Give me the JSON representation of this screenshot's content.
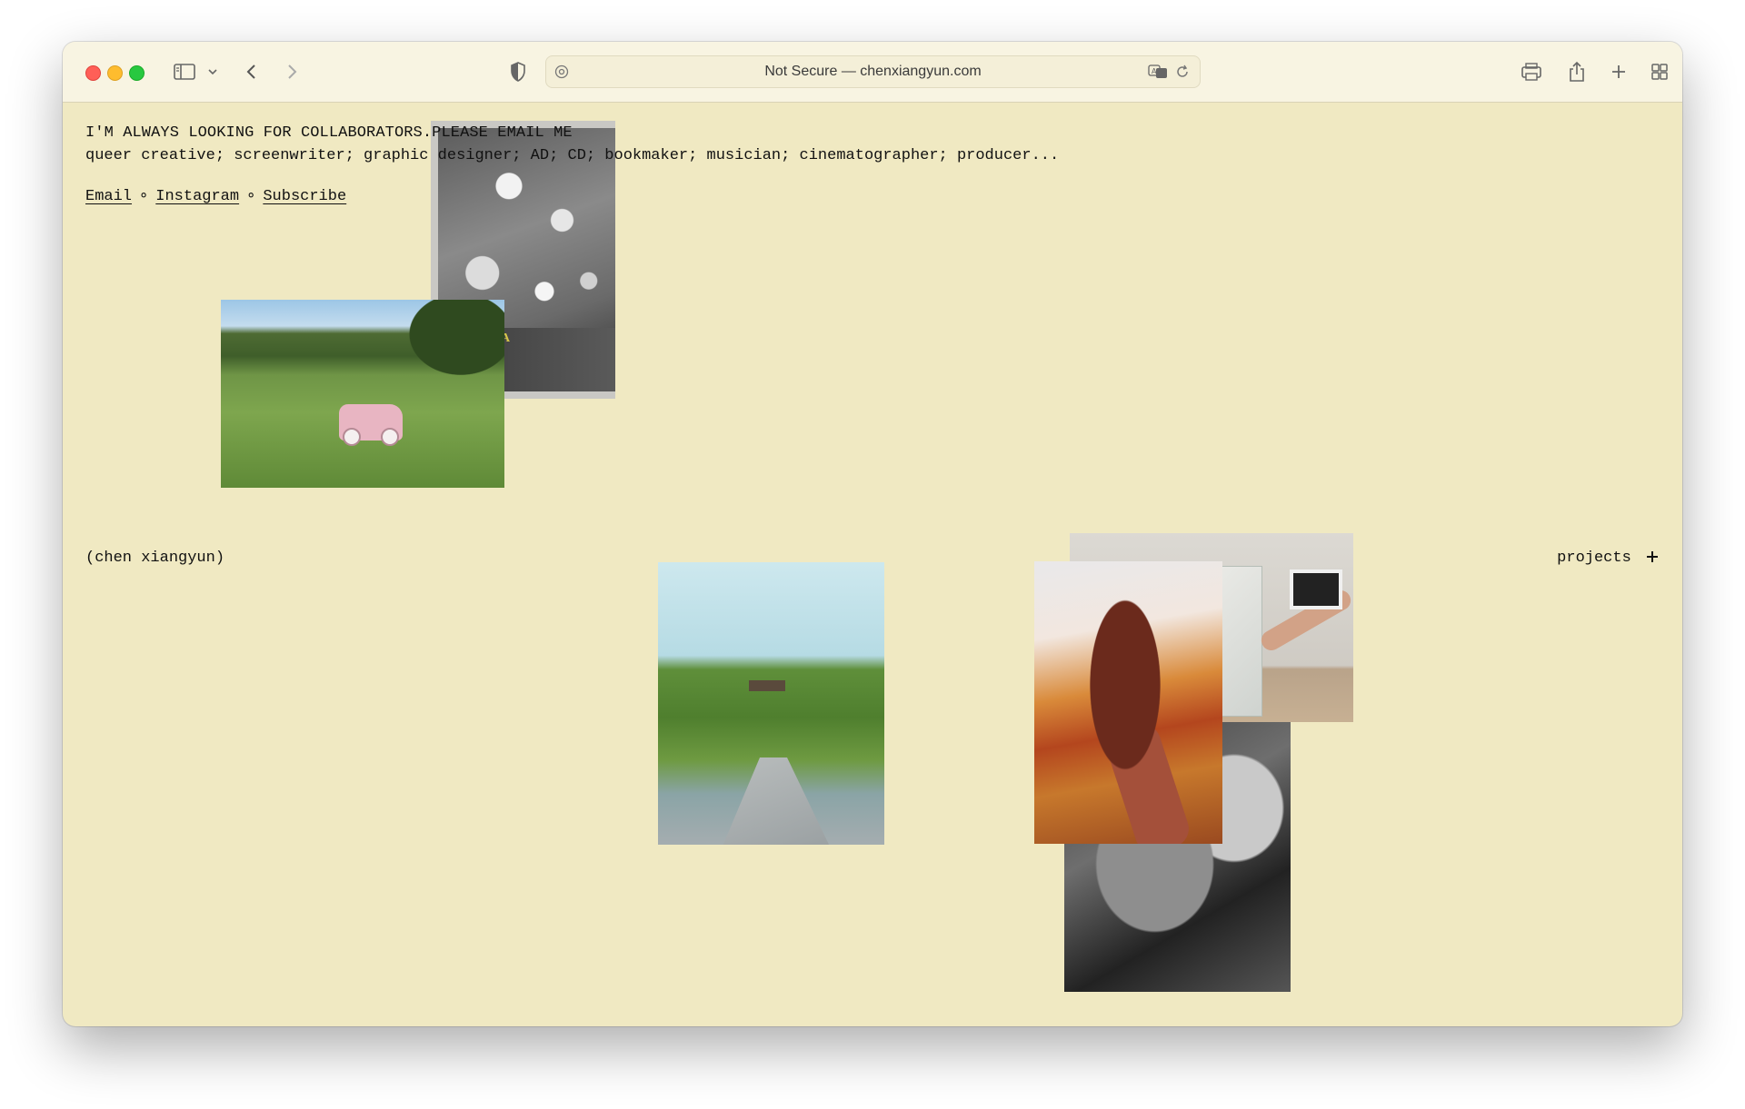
{
  "browser": {
    "url_display": "Not Secure — chenxiangyun.com",
    "traffic_lights": {
      "close": "#ff5f57",
      "minimize": "#febc2e",
      "zoom": "#28c840"
    }
  },
  "page": {
    "background_color": "#f0e9c2",
    "headline": "I'M ALWAYS LOOKING FOR COLLABORATORS.PLEASE EMAIL ME",
    "roles": "queer creative; screenwriter; graphic designer; AD; CD; bookmaker; musician; cinematographer; producer...",
    "links": {
      "email": "Email",
      "instagram": "Instagram",
      "subscribe": "Subscribe",
      "separator": "∘"
    },
    "name": "(chen xiangyun)",
    "projects_label": "projects",
    "projects_icon": "plus-icon"
  },
  "photos": [
    {
      "name": "bw-table-still-life-photo"
    },
    {
      "name": "field-toy-car-photo"
    },
    {
      "name": "grassy-hill-path-photo"
    },
    {
      "name": "package-ultrasound-photo"
    },
    {
      "name": "hand-red-hair-photo"
    },
    {
      "name": "bw-face-closeup-photo"
    }
  ]
}
